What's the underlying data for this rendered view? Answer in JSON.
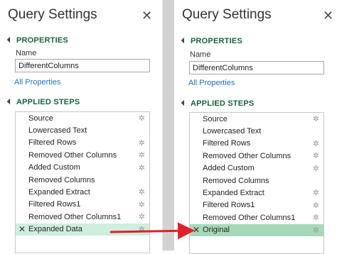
{
  "left": {
    "title": "Query Settings",
    "close": "✕",
    "properties_header": "PROPERTIES",
    "name_label": "Name",
    "name_value": "DifferentColumns",
    "all_properties": "All Properties",
    "applied_steps_header": "APPLIED STEPS",
    "steps": [
      {
        "label": "Source",
        "gear": "✲"
      },
      {
        "label": "Lowercased Text",
        "gear": ""
      },
      {
        "label": "Filtered Rows",
        "gear": "✲"
      },
      {
        "label": "Removed Other Columns",
        "gear": "✲"
      },
      {
        "label": "Added Custom",
        "gear": "✲"
      },
      {
        "label": "Removed Columns",
        "gear": ""
      },
      {
        "label": "Expanded Extract",
        "gear": "✲"
      },
      {
        "label": "Filtered Rows1",
        "gear": "✲"
      },
      {
        "label": "Removed Other Columns1",
        "gear": "✲"
      },
      {
        "label": "Expanded Data",
        "gear": "✲",
        "selected": true,
        "delete": "✕"
      }
    ]
  },
  "right": {
    "title": "Query Settings",
    "close": "✕",
    "properties_header": "PROPERTIES",
    "name_label": "Name",
    "name_value": "DifferentColumns",
    "all_properties": "All Properties",
    "applied_steps_header": "APPLIED STEPS",
    "steps": [
      {
        "label": "Source",
        "gear": "✲"
      },
      {
        "label": "Lowercased Text",
        "gear": ""
      },
      {
        "label": "Filtered Rows",
        "gear": "✲"
      },
      {
        "label": "Removed Other Columns",
        "gear": "✲"
      },
      {
        "label": "Added Custom",
        "gear": "✲"
      },
      {
        "label": "Removed Columns",
        "gear": ""
      },
      {
        "label": "Expanded Extract",
        "gear": "✲"
      },
      {
        "label": "Filtered Rows1",
        "gear": "✲"
      },
      {
        "label": "Removed Other Columns1",
        "gear": "✲"
      },
      {
        "label": "Original",
        "gear": "✲",
        "selected": true,
        "delete": "✕"
      }
    ]
  },
  "colors": {
    "section_header": "#17633d",
    "link": "#1f6fc5",
    "arrow": "#e0202a",
    "selected_left": "#cfeede",
    "selected_right": "#a6d9ba"
  }
}
